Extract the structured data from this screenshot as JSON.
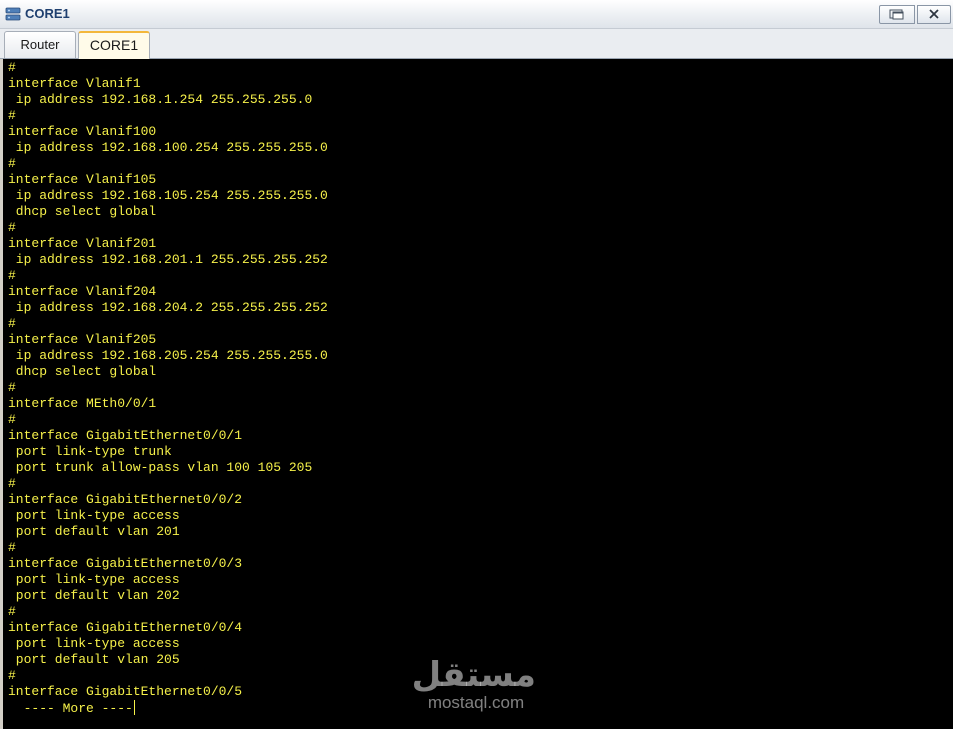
{
  "window": {
    "title": "CORE1",
    "app_icon": "network-device-icon",
    "controls": [
      "restore-icon",
      "close-icon"
    ]
  },
  "tabs": [
    {
      "label": "Router",
      "active": false
    },
    {
      "label": "CORE1",
      "active": true
    }
  ],
  "terminal": {
    "text_color": "#f6f14a",
    "background_color": "#000000",
    "lines": [
      "#",
      "interface Vlanif1",
      " ip address 192.168.1.254 255.255.255.0",
      "#",
      "interface Vlanif100",
      " ip address 192.168.100.254 255.255.255.0",
      "#",
      "interface Vlanif105",
      " ip address 192.168.105.254 255.255.255.0",
      " dhcp select global",
      "#",
      "interface Vlanif201",
      " ip address 192.168.201.1 255.255.255.252",
      "#",
      "interface Vlanif204",
      " ip address 192.168.204.2 255.255.255.252",
      "#",
      "interface Vlanif205",
      " ip address 192.168.205.254 255.255.255.0",
      " dhcp select global",
      "#",
      "interface MEth0/0/1",
      "#",
      "interface GigabitEthernet0/0/1",
      " port link-type trunk",
      " port trunk allow-pass vlan 100 105 205",
      "#",
      "interface GigabitEthernet0/0/2",
      " port link-type access",
      " port default vlan 201",
      "#",
      "interface GigabitEthernet0/0/3",
      " port link-type access",
      " port default vlan 202",
      "#",
      "interface GigabitEthernet0/0/4",
      " port link-type access",
      " port default vlan 205",
      "#",
      "interface GigabitEthernet0/0/5"
    ],
    "more_prompt": "  ---- More ----"
  },
  "watermark": {
    "logo_text": "مستقل",
    "site": "mostaql.com"
  }
}
